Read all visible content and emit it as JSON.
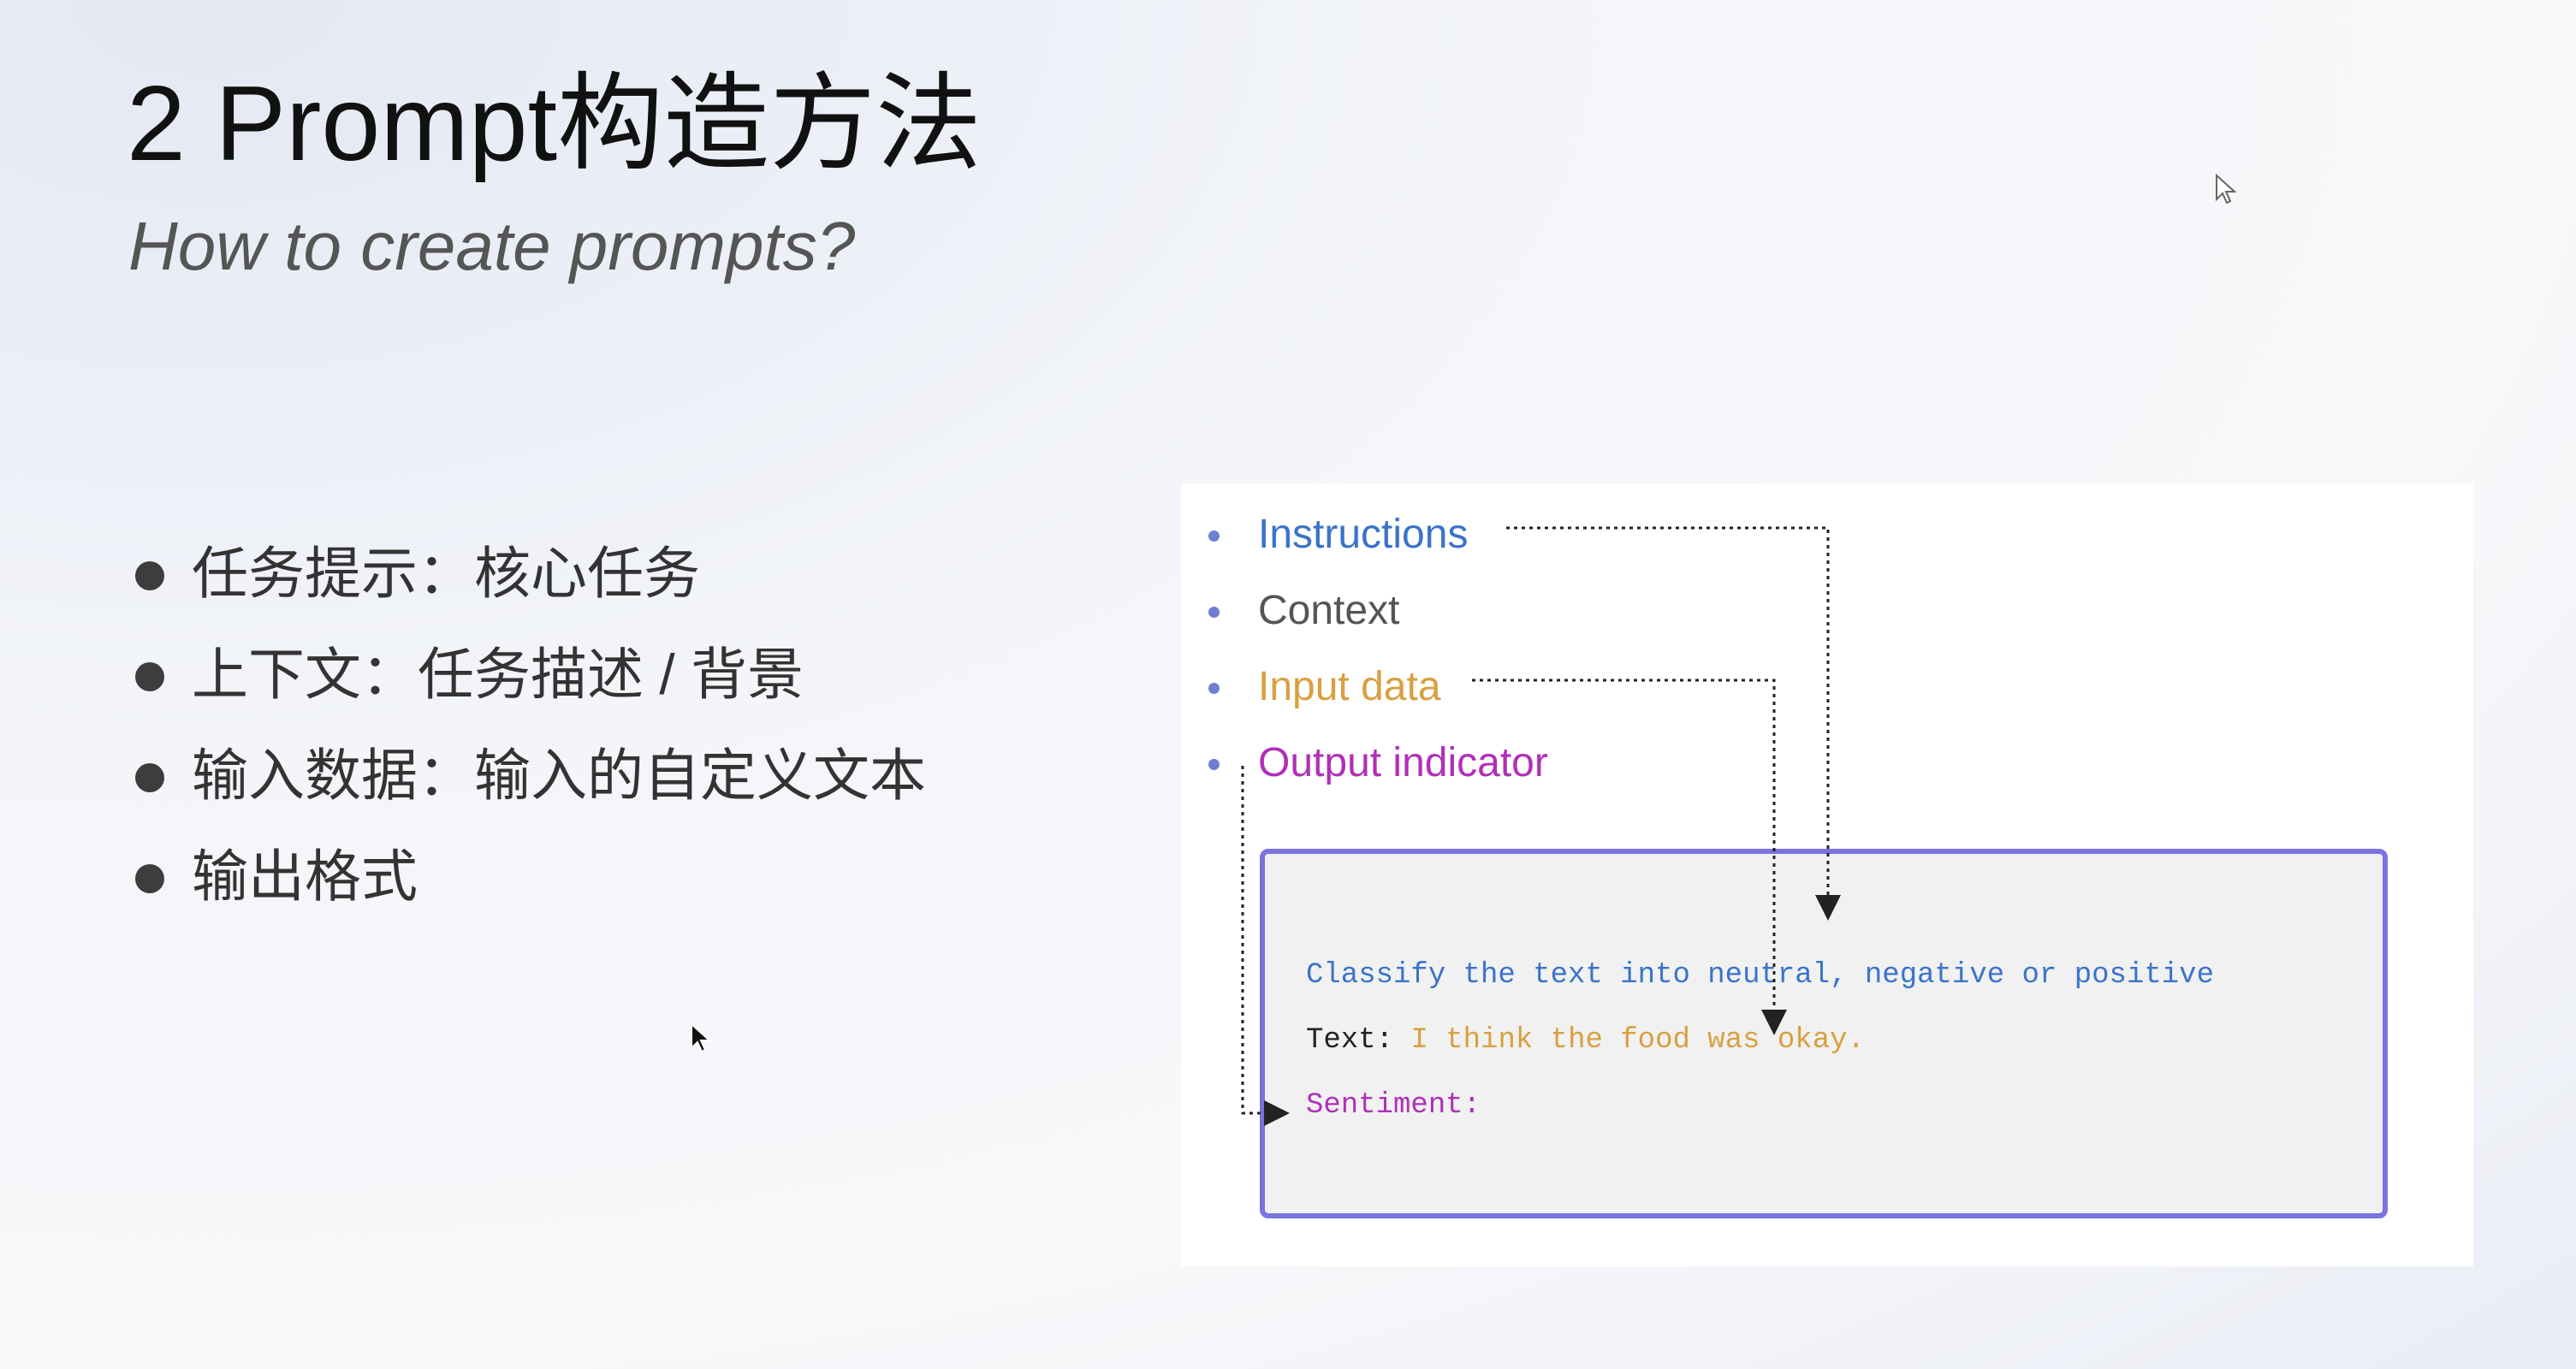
{
  "slide": {
    "title": "2 Prompt构造方法",
    "subtitle": "How to create prompts?"
  },
  "left_bullets": [
    "任务提示：核心任务",
    "上下文：任务描述 / 背景",
    "输入数据：输入的自定义文本",
    "输出格式"
  ],
  "components": [
    {
      "label": "Instructions",
      "color": "#3a73c9"
    },
    {
      "label": "Context",
      "color": "#555555"
    },
    {
      "label": "Input data",
      "color": "#d8a040"
    },
    {
      "label": "Output indicator",
      "color": "#b030b8"
    }
  ],
  "prompt_example": {
    "instruction_text": "Classify the text into neutral, negative or positive",
    "text_label": "Text:",
    "text_value": "I think the food was okay.",
    "output_label": "Sentiment:"
  },
  "colors": {
    "instruction": "#3a73c9",
    "context": "#555555",
    "input": "#d8a040",
    "output": "#b030b8",
    "box_border": "#7b73e0",
    "box_fill": "#f1f1f1"
  },
  "icons": [
    "pointer-cursor-icon",
    "hollow-cursor-icon",
    "bullet-dot-icon"
  ]
}
